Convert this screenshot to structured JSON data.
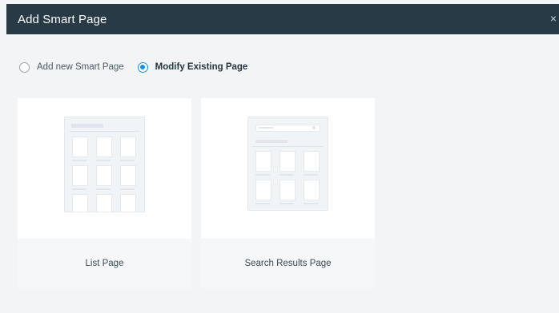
{
  "dialog": {
    "title": "Add Smart Page",
    "close_glyph": "×"
  },
  "mode_options": [
    {
      "label": "Add new Smart Page",
      "selected": false
    },
    {
      "label": "Modify Existing Page",
      "selected": true
    }
  ],
  "cards": [
    {
      "label": "List Page",
      "thumbnail_icon": "list-page-wireframe-icon"
    },
    {
      "label": "Search Results Page",
      "thumbnail_icon": "search-results-wireframe-icon"
    }
  ],
  "colors": {
    "header_bg": "#283a46",
    "accent": "#1592e6",
    "page_bg": "#f2f4f6"
  }
}
